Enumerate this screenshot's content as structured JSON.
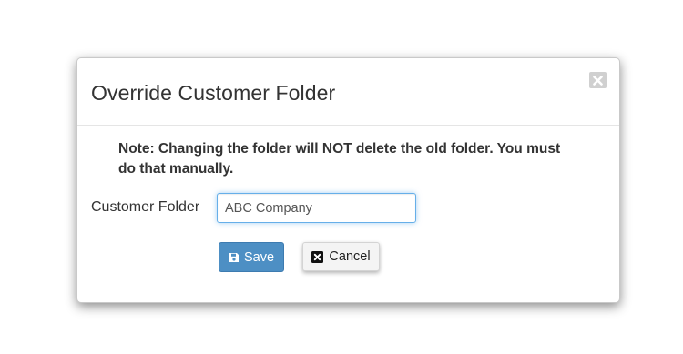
{
  "dialog": {
    "title": "Override Customer Folder",
    "close_icon": "close-icon",
    "note": "Note: Changing the folder will NOT delete the old folder. You must do that manually.",
    "field": {
      "label": "Customer Folder",
      "value": "ABC Company"
    },
    "buttons": {
      "save_label": "Save",
      "save_icon": "floppy-disk-icon",
      "cancel_label": "Cancel",
      "cancel_icon": "close-square-icon"
    }
  },
  "colors": {
    "primary_button": "#4d8fc4",
    "input_focus_border": "#66afe9",
    "close_button": "#d0d0d0"
  }
}
